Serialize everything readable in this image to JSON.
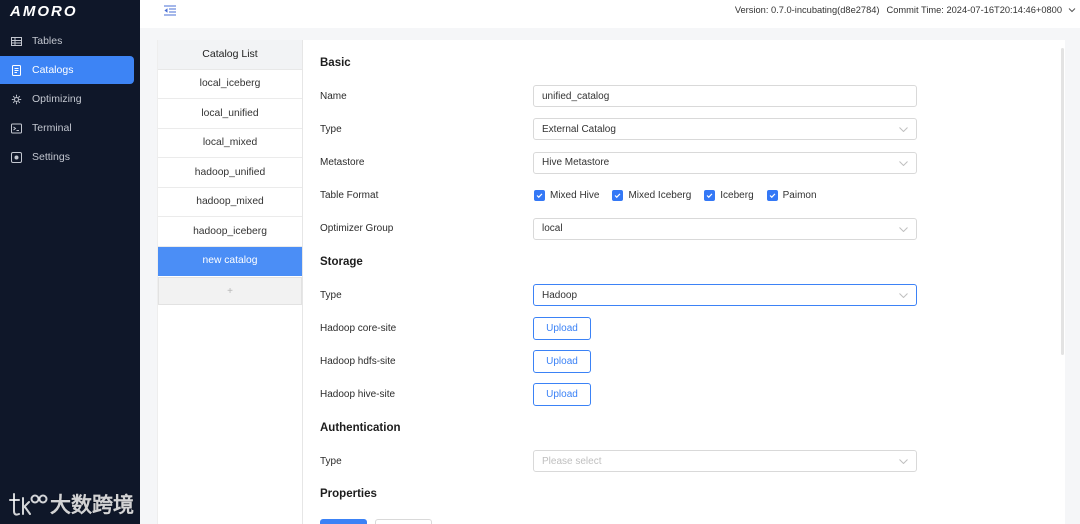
{
  "theme": {
    "sidebar_bg": "#0f1729",
    "accent": "#3d84f5",
    "page_bg": "#f5f6f8"
  },
  "logo": {
    "text": "AMORO"
  },
  "sidebar": {
    "items": [
      {
        "label": "Tables",
        "icon": "table-icon",
        "active": false
      },
      {
        "label": "Catalogs",
        "icon": "catalog-icon",
        "active": true
      },
      {
        "label": "Optimizing",
        "icon": "optimizing-icon",
        "active": false
      },
      {
        "label": "Terminal",
        "icon": "terminal-icon",
        "active": false
      },
      {
        "label": "Settings",
        "icon": "settings-icon",
        "active": false
      }
    ]
  },
  "header": {
    "version": "Version: 0.7.0-incubating(d8e2784)",
    "commit_time": "Commit Time: 2024-07-16T20:14:46+0800"
  },
  "catalog_list": {
    "title": "Catalog List",
    "items": [
      {
        "name": "local_iceberg",
        "active": false
      },
      {
        "name": "local_unified",
        "active": false
      },
      {
        "name": "local_mixed",
        "active": false
      },
      {
        "name": "hadoop_unified",
        "active": false
      },
      {
        "name": "hadoop_mixed",
        "active": false
      },
      {
        "name": "hadoop_iceberg",
        "active": false
      },
      {
        "name": "new catalog",
        "active": true
      }
    ],
    "add_label": "+"
  },
  "form": {
    "basic": {
      "heading": "Basic",
      "name": {
        "label": "Name",
        "value": "unified_catalog"
      },
      "type": {
        "label": "Type",
        "value": "External Catalog"
      },
      "metastore": {
        "label": "Metastore",
        "value": "Hive Metastore"
      },
      "table_format": {
        "label": "Table Format",
        "options": [
          {
            "label": "Mixed Hive",
            "checked": true
          },
          {
            "label": "Mixed Iceberg",
            "checked": true
          },
          {
            "label": "Iceberg",
            "checked": true
          },
          {
            "label": "Paimon",
            "checked": true
          }
        ]
      },
      "optimizer_group": {
        "label": "Optimizer Group",
        "value": "local"
      }
    },
    "storage": {
      "heading": "Storage",
      "type": {
        "label": "Type",
        "value": "Hadoop",
        "focused": true
      },
      "core_site": {
        "label": "Hadoop core-site",
        "button": "Upload"
      },
      "hdfs_site": {
        "label": "Hadoop hdfs-site",
        "button": "Upload"
      },
      "hive_site": {
        "label": "Hadoop hive-site",
        "button": "Upload"
      }
    },
    "authentication": {
      "heading": "Authentication",
      "type": {
        "label": "Type",
        "placeholder": "Please select"
      }
    },
    "properties": {
      "heading": "Properties"
    }
  },
  "watermark": {
    "text": "大数跨境"
  }
}
